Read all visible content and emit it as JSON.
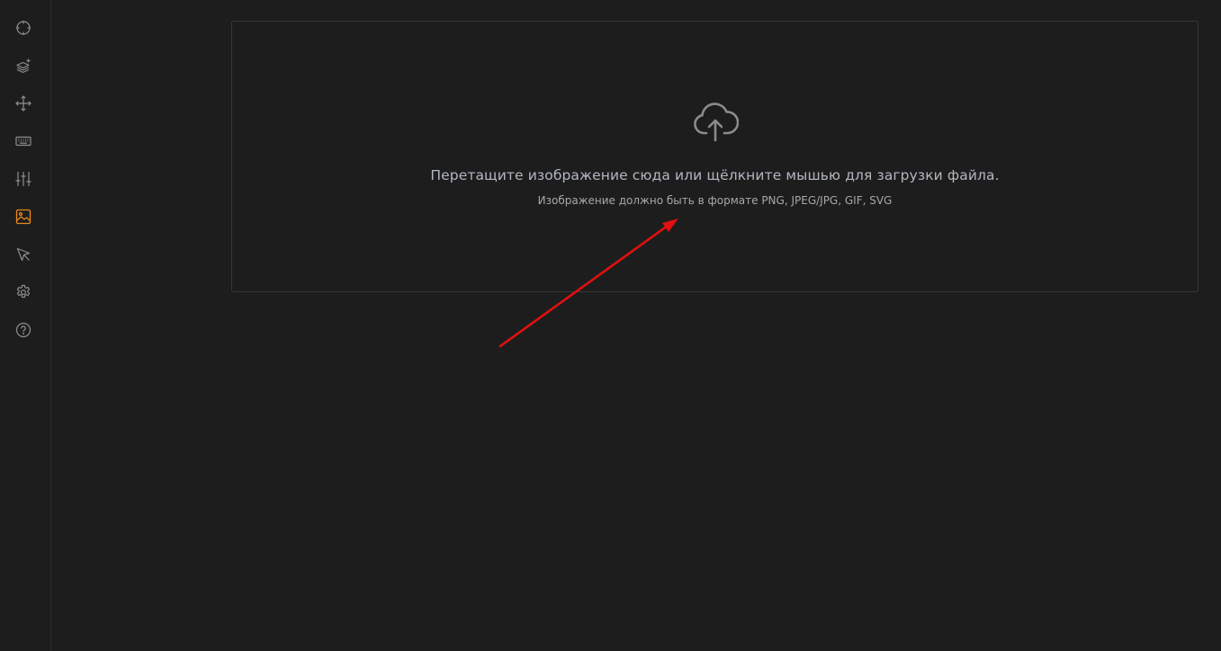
{
  "sidebar": {
    "items": [
      {
        "icon": "crosshair-icon",
        "active": false
      },
      {
        "icon": "layers-add-icon",
        "active": false
      },
      {
        "icon": "move-arrows-icon",
        "active": false
      },
      {
        "icon": "keyboard-icon",
        "active": false
      },
      {
        "icon": "sliders-icon",
        "active": false
      },
      {
        "icon": "image-icon",
        "active": true
      },
      {
        "icon": "cursor-icon",
        "active": false
      },
      {
        "icon": "gear-icon",
        "active": false
      },
      {
        "icon": "help-icon",
        "active": false
      }
    ],
    "active_color": "#e8881e",
    "icon_color": "#8e8e8e"
  },
  "dropzone": {
    "icon": "cloud-upload-icon",
    "title": "Перетащите изображение сюда или щёлкните мышью для загрузки файла.",
    "hint": "Изображение должно быть в формате PNG, JPEG/JPG, GIF, SVG"
  },
  "annotation": {
    "type": "red-arrow",
    "color": "#e01010"
  },
  "colors": {
    "background": "#1d1d1d",
    "border": "#383838"
  }
}
